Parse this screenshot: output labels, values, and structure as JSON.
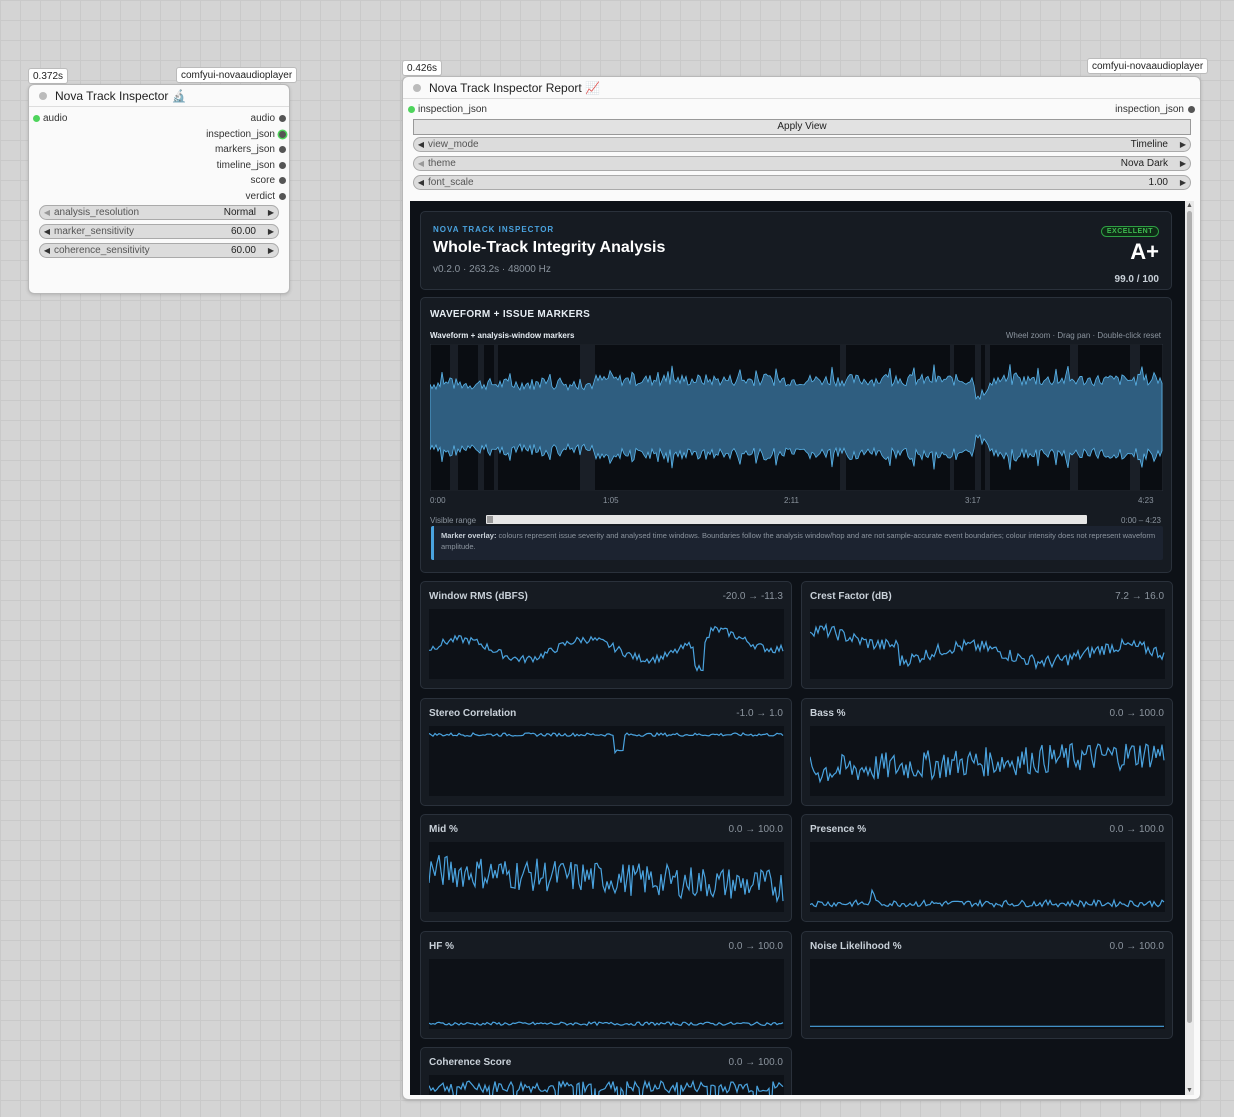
{
  "node1": {
    "timing": "0.372s",
    "pack": "comfyui-novaaudioplayer",
    "title": "Nova Track Inspector 🔬",
    "input": "audio",
    "outputs": [
      "audio",
      "inspection_json",
      "markers_json",
      "timeline_json",
      "score",
      "verdict"
    ],
    "widgets": [
      {
        "label": "analysis_resolution",
        "value": "Normal"
      },
      {
        "label": "marker_sensitivity",
        "value": "60.00"
      },
      {
        "label": "coherence_sensitivity",
        "value": "60.00"
      }
    ]
  },
  "node2": {
    "timing": "0.426s",
    "pack": "comfyui-novaaudioplayer",
    "title": "Nova Track Inspector Report 📈",
    "input": "inspection_json",
    "output": "inspection_json",
    "apply_label": "Apply View",
    "widgets": [
      {
        "label": "view_mode",
        "value": "Timeline"
      },
      {
        "label": "theme",
        "value": "Nova Dark"
      },
      {
        "label": "font_scale",
        "value": "1.00"
      }
    ]
  },
  "report": {
    "eyebrow": "NOVA TRACK INSPECTOR",
    "title": "Whole-Track Integrity Analysis",
    "subtitle": "v0.2.0 · 263.2s · 48000 Hz",
    "badge": "EXCELLENT",
    "grade": "A+",
    "score": "99.0 / 100",
    "waveform": {
      "section_title": "WAVEFORM + ISSUE MARKERS",
      "label": "Waveform + analysis-window markers",
      "hint": "Wheel zoom · Drag pan · Double-click reset",
      "ticks": [
        "0:00",
        "1:05",
        "2:11",
        "3:17",
        "4:23"
      ],
      "range_label": "Visible range",
      "range_value": "0:00 – 4:23",
      "note_bold": "Marker overlay:",
      "note_text": " colours represent issue severity and analysed time windows. Boundaries follow the analysis window/hop and are not sample-accurate event boundaries; colour intensity does not represent waveform amplitude."
    },
    "accent": "#4aa3df",
    "metrics": [
      {
        "title": "Window RMS (dBFS)",
        "range": "-20.0 → -11.3",
        "shape": "rms"
      },
      {
        "title": "Crest Factor (dB)",
        "range": "7.2 → 16.0",
        "shape": "crest"
      },
      {
        "title": "Stereo Correlation",
        "range": "-1.0 → 1.0",
        "shape": "corr"
      },
      {
        "title": "Bass %",
        "range": "0.0 → 100.0",
        "shape": "bass"
      },
      {
        "title": "Mid %",
        "range": "0.0 → 100.0",
        "shape": "mid"
      },
      {
        "title": "Presence %",
        "range": "0.0 → 100.0",
        "shape": "presence"
      },
      {
        "title": "HF %",
        "range": "0.0 → 100.0",
        "shape": "hf"
      },
      {
        "title": "Noise Likelihood %",
        "range": "0.0 → 100.0",
        "shape": "noise"
      },
      {
        "title": "Coherence Score",
        "range": "0.0 → 100.0",
        "shape": "coherence"
      }
    ]
  }
}
